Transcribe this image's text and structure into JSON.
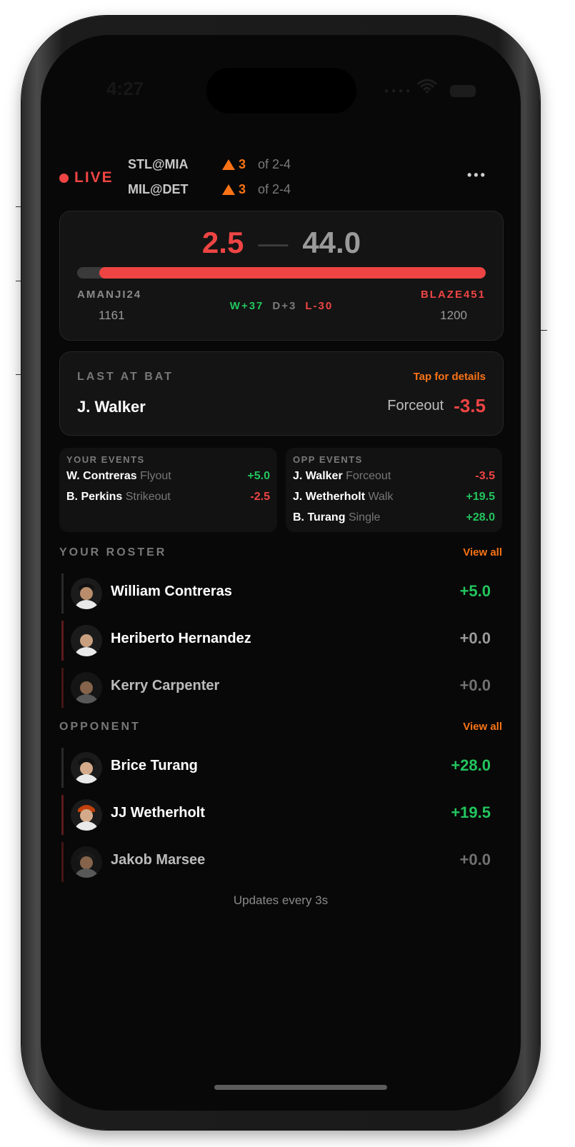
{
  "status_bar": {
    "time": "4:27"
  },
  "header": {
    "live_label": "LIVE",
    "games": [
      {
        "code": "STL@MIA",
        "inning": "3",
        "of": "of 2-4"
      },
      {
        "code": "MIL@DET",
        "inning": "3",
        "of": "of 2-4"
      }
    ],
    "more_glyph": "•••"
  },
  "scoreboard": {
    "score_left": "2.5",
    "score_sep": "—",
    "score_right": "44.0",
    "left_share": 0.054,
    "left_player": {
      "name": "AMANJI24",
      "elo": "1161"
    },
    "right_player": {
      "name": "BLAZE451",
      "elo": "1200"
    },
    "record": {
      "w": "W+37",
      "d": "D+3",
      "l": "L-30"
    }
  },
  "last_at_bat": {
    "title": "LAST AT BAT",
    "tap_label": "Tap for details",
    "player": "J. Walker",
    "event": "Forceout",
    "points": "-3.5"
  },
  "your_events": {
    "title": "YOUR EVENTS",
    "rows": [
      {
        "name": "W. Contreras",
        "type": "Flyout",
        "points": "+5.0"
      },
      {
        "name": "B. Perkins",
        "type": "Strikeout",
        "points": "-2.5"
      }
    ]
  },
  "opp_events": {
    "title": "OPP EVENTS",
    "rows": [
      {
        "name": "J. Walker",
        "type": "Forceout",
        "points": "-3.5"
      },
      {
        "name": "J. Wetherholt",
        "type": "Walk",
        "points": "+19.5"
      },
      {
        "name": "B. Turang",
        "type": "Single",
        "points": "+28.0"
      }
    ]
  },
  "your_roster": {
    "title": "YOUR ROSTER",
    "view_all": "View all",
    "players": [
      {
        "name": "William Contreras",
        "points": "+5.0"
      },
      {
        "name": "Heriberto Hernandez",
        "points": "+0.0"
      },
      {
        "name": "Kerry Carpenter",
        "points": "+0.0"
      }
    ]
  },
  "opponent": {
    "title": "OPPONENT",
    "view_all": "View all",
    "players": [
      {
        "name": "Brice Turang",
        "points": "+28.0"
      },
      {
        "name": "JJ Wetherholt",
        "points": "+19.5"
      },
      {
        "name": "Jakob Marsee",
        "points": "+0.0"
      }
    ]
  },
  "footer": {
    "text": "Updates every 3s"
  },
  "colors": {
    "accent": "#f97316",
    "negative": "#ef4444",
    "positive": "#22c55e",
    "background": "#080808"
  }
}
